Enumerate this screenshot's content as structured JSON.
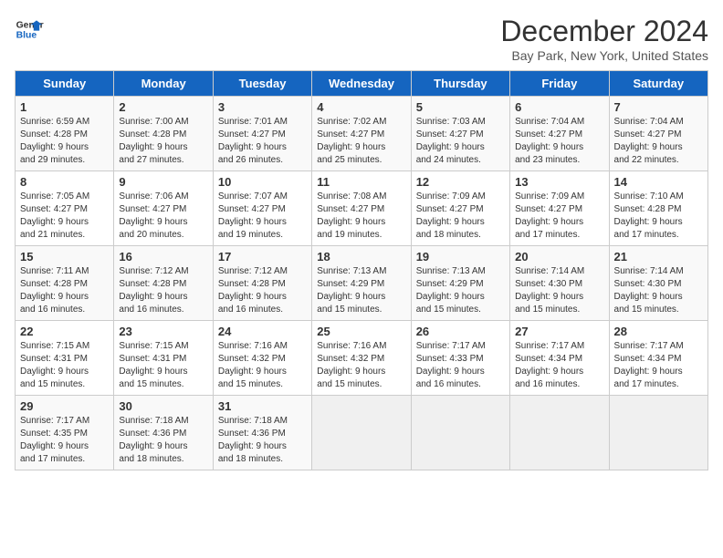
{
  "header": {
    "logo_line1": "General",
    "logo_line2": "Blue",
    "title": "December 2024",
    "subtitle": "Bay Park, New York, United States"
  },
  "weekdays": [
    "Sunday",
    "Monday",
    "Tuesday",
    "Wednesday",
    "Thursday",
    "Friday",
    "Saturday"
  ],
  "weeks": [
    [
      {
        "day": "1",
        "sunrise": "6:59 AM",
        "sunset": "4:28 PM",
        "daylight": "9 hours and 29 minutes."
      },
      {
        "day": "2",
        "sunrise": "7:00 AM",
        "sunset": "4:28 PM",
        "daylight": "9 hours and 27 minutes."
      },
      {
        "day": "3",
        "sunrise": "7:01 AM",
        "sunset": "4:27 PM",
        "daylight": "9 hours and 26 minutes."
      },
      {
        "day": "4",
        "sunrise": "7:02 AM",
        "sunset": "4:27 PM",
        "daylight": "9 hours and 25 minutes."
      },
      {
        "day": "5",
        "sunrise": "7:03 AM",
        "sunset": "4:27 PM",
        "daylight": "9 hours and 24 minutes."
      },
      {
        "day": "6",
        "sunrise": "7:04 AM",
        "sunset": "4:27 PM",
        "daylight": "9 hours and 23 minutes."
      },
      {
        "day": "7",
        "sunrise": "7:04 AM",
        "sunset": "4:27 PM",
        "daylight": "9 hours and 22 minutes."
      }
    ],
    [
      {
        "day": "8",
        "sunrise": "7:05 AM",
        "sunset": "4:27 PM",
        "daylight": "9 hours and 21 minutes."
      },
      {
        "day": "9",
        "sunrise": "7:06 AM",
        "sunset": "4:27 PM",
        "daylight": "9 hours and 20 minutes."
      },
      {
        "day": "10",
        "sunrise": "7:07 AM",
        "sunset": "4:27 PM",
        "daylight": "9 hours and 19 minutes."
      },
      {
        "day": "11",
        "sunrise": "7:08 AM",
        "sunset": "4:27 PM",
        "daylight": "9 hours and 19 minutes."
      },
      {
        "day": "12",
        "sunrise": "7:09 AM",
        "sunset": "4:27 PM",
        "daylight": "9 hours and 18 minutes."
      },
      {
        "day": "13",
        "sunrise": "7:09 AM",
        "sunset": "4:27 PM",
        "daylight": "9 hours and 17 minutes."
      },
      {
        "day": "14",
        "sunrise": "7:10 AM",
        "sunset": "4:28 PM",
        "daylight": "9 hours and 17 minutes."
      }
    ],
    [
      {
        "day": "15",
        "sunrise": "7:11 AM",
        "sunset": "4:28 PM",
        "daylight": "9 hours and 16 minutes."
      },
      {
        "day": "16",
        "sunrise": "7:12 AM",
        "sunset": "4:28 PM",
        "daylight": "9 hours and 16 minutes."
      },
      {
        "day": "17",
        "sunrise": "7:12 AM",
        "sunset": "4:28 PM",
        "daylight": "9 hours and 16 minutes."
      },
      {
        "day": "18",
        "sunrise": "7:13 AM",
        "sunset": "4:29 PM",
        "daylight": "9 hours and 15 minutes."
      },
      {
        "day": "19",
        "sunrise": "7:13 AM",
        "sunset": "4:29 PM",
        "daylight": "9 hours and 15 minutes."
      },
      {
        "day": "20",
        "sunrise": "7:14 AM",
        "sunset": "4:30 PM",
        "daylight": "9 hours and 15 minutes."
      },
      {
        "day": "21",
        "sunrise": "7:14 AM",
        "sunset": "4:30 PM",
        "daylight": "9 hours and 15 minutes."
      }
    ],
    [
      {
        "day": "22",
        "sunrise": "7:15 AM",
        "sunset": "4:31 PM",
        "daylight": "9 hours and 15 minutes."
      },
      {
        "day": "23",
        "sunrise": "7:15 AM",
        "sunset": "4:31 PM",
        "daylight": "9 hours and 15 minutes."
      },
      {
        "day": "24",
        "sunrise": "7:16 AM",
        "sunset": "4:32 PM",
        "daylight": "9 hours and 15 minutes."
      },
      {
        "day": "25",
        "sunrise": "7:16 AM",
        "sunset": "4:32 PM",
        "daylight": "9 hours and 15 minutes."
      },
      {
        "day": "26",
        "sunrise": "7:17 AM",
        "sunset": "4:33 PM",
        "daylight": "9 hours and 16 minutes."
      },
      {
        "day": "27",
        "sunrise": "7:17 AM",
        "sunset": "4:34 PM",
        "daylight": "9 hours and 16 minutes."
      },
      {
        "day": "28",
        "sunrise": "7:17 AM",
        "sunset": "4:34 PM",
        "daylight": "9 hours and 17 minutes."
      }
    ],
    [
      {
        "day": "29",
        "sunrise": "7:17 AM",
        "sunset": "4:35 PM",
        "daylight": "9 hours and 17 minutes."
      },
      {
        "day": "30",
        "sunrise": "7:18 AM",
        "sunset": "4:36 PM",
        "daylight": "9 hours and 18 minutes."
      },
      {
        "day": "31",
        "sunrise": "7:18 AM",
        "sunset": "4:36 PM",
        "daylight": "9 hours and 18 minutes."
      },
      null,
      null,
      null,
      null
    ]
  ]
}
